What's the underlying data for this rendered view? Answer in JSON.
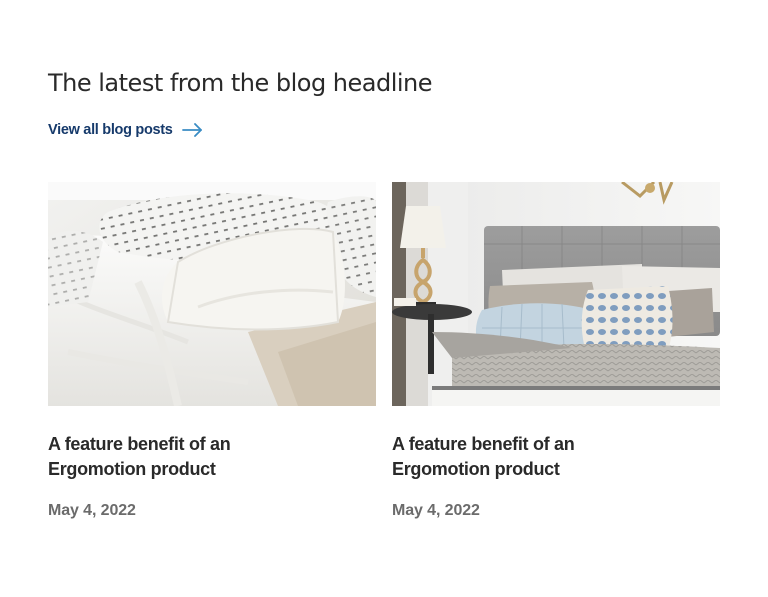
{
  "blog": {
    "headline": "The latest from the blog headline",
    "view_all_label": "View all blog posts",
    "view_all_icon": "arrow-right-icon",
    "accent_color": "#163a6b",
    "arrow_color": "#3a8cc4",
    "posts": [
      {
        "image": "white-bedding-pillows-photo",
        "title": "A feature benefit of an Ergomotion product",
        "date": "May 4, 2022"
      },
      {
        "image": "gray-bed-with-blue-pillows-photo",
        "title": "A feature benefit of an Ergomotion product",
        "date": "May 4, 2022"
      }
    ]
  }
}
